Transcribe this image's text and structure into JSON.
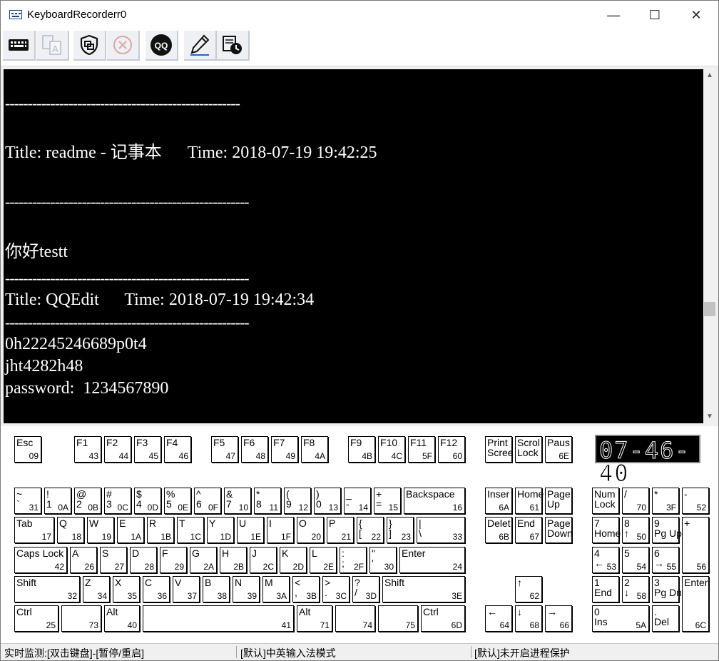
{
  "window": {
    "title": "KeyboardRecorderr0",
    "minimize": "—",
    "maximize": "☐",
    "close": "✕"
  },
  "toolbar": [
    {
      "name": "keyboard-icon",
      "enabled": true
    },
    {
      "name": "translate-icon",
      "enabled": false
    },
    {
      "name": "shield-icon",
      "enabled": true
    },
    {
      "name": "stop-icon",
      "enabled": false
    },
    {
      "name": "qq-icon",
      "label": "QQ",
      "enabled": true
    },
    {
      "name": "pencil-icon",
      "enabled": true
    },
    {
      "name": "log-clock-icon",
      "enabled": true
    }
  ],
  "console": {
    "lines": [
      {
        "text": "----------------------------------------------------",
        "dash": true
      },
      {
        "text": "Title: readme - 记事本      Time: 2018-07-19 19:42:25",
        "dash": false
      },
      {
        "text": "------------------------------------------------------",
        "dash": true
      },
      {
        "text": "你好testt",
        "dash": false
      },
      {
        "text": "------------------------------------------------------",
        "dash": true
      },
      {
        "text": "Title: QQEdit      Time: 2018-07-19 19:42:34",
        "dash": false
      },
      {
        "text": "------------------------------------------------------",
        "dash": true
      },
      {
        "text": "0h22245246689p0t4",
        "dash": false
      },
      {
        "text": "jht4282h48",
        "dash": false
      },
      {
        "text": "password:  1234567890",
        "dash": false
      }
    ]
  },
  "clock": "07-46-40",
  "keys": [
    {
      "l": "Esc",
      "c": "09"
    },
    {
      "l": "F1",
      "c": "43"
    },
    {
      "l": "F2",
      "c": "44"
    },
    {
      "l": "F3",
      "c": "45"
    },
    {
      "l": "F4",
      "c": "46"
    },
    {
      "l": "F5",
      "c": "47"
    },
    {
      "l": "F6",
      "c": "48"
    },
    {
      "l": "F7",
      "c": "49"
    },
    {
      "l": "F8",
      "c": "4A"
    },
    {
      "l": "F9",
      "c": "4B"
    },
    {
      "l": "F10",
      "c": "4C"
    },
    {
      "l": "F11",
      "c": "5F"
    },
    {
      "l": "F12",
      "c": "60"
    },
    {
      "l": "Print\nScree",
      "c": ""
    },
    {
      "l": "Scrol\nLock",
      "c": ""
    },
    {
      "l": "Paus",
      "c": "6E"
    },
    {
      "l": "~\n`",
      "c": "31"
    },
    {
      "l": "!\n1",
      "c": "0A"
    },
    {
      "l": "@\n2",
      "c": "0B"
    },
    {
      "l": "#\n3",
      "c": "0C"
    },
    {
      "l": "$\n4",
      "c": "0D"
    },
    {
      "l": "%\n5",
      "c": "0E"
    },
    {
      "l": "^\n6",
      "c": "0F"
    },
    {
      "l": "&\n7",
      "c": "10"
    },
    {
      "l": "*\n8",
      "c": "11"
    },
    {
      "l": "(\n9",
      "c": "12"
    },
    {
      "l": ")\n0",
      "c": "13"
    },
    {
      "l": "_\n-",
      "c": "14"
    },
    {
      "l": "+\n=",
      "c": "15"
    },
    {
      "l": "Backspace",
      "c": "16"
    },
    {
      "l": "Tab",
      "c": "17"
    },
    {
      "l": "Q",
      "c": "18"
    },
    {
      "l": "W",
      "c": "19"
    },
    {
      "l": "E",
      "c": "1A"
    },
    {
      "l": "R",
      "c": "1B"
    },
    {
      "l": "T",
      "c": "1C"
    },
    {
      "l": "Y",
      "c": "1D"
    },
    {
      "l": "U",
      "c": "1E"
    },
    {
      "l": "I",
      "c": "1F"
    },
    {
      "l": "O",
      "c": "20"
    },
    {
      "l": "P",
      "c": "21"
    },
    {
      "l": "{\n[",
      "c": "22"
    },
    {
      "l": "}\n]",
      "c": "23"
    },
    {
      "l": "|\n\\",
      "c": "33"
    },
    {
      "l": "Caps Lock",
      "c": "42"
    },
    {
      "l": "A",
      "c": "26"
    },
    {
      "l": "S",
      "c": "27"
    },
    {
      "l": "D",
      "c": "28"
    },
    {
      "l": "F",
      "c": "29"
    },
    {
      "l": "G",
      "c": "2A"
    },
    {
      "l": "H",
      "c": "2B"
    },
    {
      "l": "J",
      "c": "2C"
    },
    {
      "l": "K",
      "c": "2D"
    },
    {
      "l": "L",
      "c": "2E"
    },
    {
      "l": ":\n;",
      "c": "2F"
    },
    {
      "l": "\"\n'",
      "c": "30"
    },
    {
      "l": "Enter",
      "c": "24"
    },
    {
      "l": "Shift",
      "c": "32"
    },
    {
      "l": "Z",
      "c": "34"
    },
    {
      "l": "X",
      "c": "35"
    },
    {
      "l": "C",
      "c": "36"
    },
    {
      "l": "V",
      "c": "37"
    },
    {
      "l": "B",
      "c": "38"
    },
    {
      "l": "N",
      "c": "39"
    },
    {
      "l": "M",
      "c": "3A"
    },
    {
      "l": "<\n,",
      "c": "3B"
    },
    {
      "l": ">\n.",
      "c": "3C"
    },
    {
      "l": "?\n/",
      "c": "3D"
    },
    {
      "l": "Shift",
      "c": "3E"
    },
    {
      "l": "Ctrl",
      "c": "25"
    },
    {
      "l": "",
      "c": "73"
    },
    {
      "l": "Alt",
      "c": "40"
    },
    {
      "l": "",
      "c": "41"
    },
    {
      "l": "Alt",
      "c": "71"
    },
    {
      "l": "",
      "c": "74"
    },
    {
      "l": "",
      "c": "75"
    },
    {
      "l": "Ctrl",
      "c": "6D"
    },
    {
      "l": "Inser",
      "c": "6A"
    },
    {
      "l": "Home",
      "c": "61"
    },
    {
      "l": "Page\nUp",
      "c": ""
    },
    {
      "l": "Delet",
      "c": "6B"
    },
    {
      "l": "End",
      "c": "67"
    },
    {
      "l": "Page\nDown",
      "c": ""
    },
    {
      "l": "↑",
      "c": "62"
    },
    {
      "l": "←",
      "c": "64"
    },
    {
      "l": "↓",
      "c": "68"
    },
    {
      "l": "→",
      "c": "66"
    },
    {
      "l": "Num\nLock",
      "c": ""
    },
    {
      "l": "/",
      "c": "70"
    },
    {
      "l": "*",
      "c": "3F"
    },
    {
      "l": "-",
      "c": "52"
    },
    {
      "l": "7\nHome",
      "c": ""
    },
    {
      "l": "8\n↑",
      "c": "50"
    },
    {
      "l": "9\nPg Up",
      "c": ""
    },
    {
      "l": "+",
      "c": "56"
    },
    {
      "l": "4\n←",
      "c": "53"
    },
    {
      "l": "5",
      "c": "54"
    },
    {
      "l": "6\n→",
      "c": "55"
    },
    {
      "l": "1\nEnd",
      "c": ""
    },
    {
      "l": "2\n↓",
      "c": "58"
    },
    {
      "l": "3\nPg Dn",
      "c": ""
    },
    {
      "l": "Enter",
      "c": "6C"
    },
    {
      "l": "0\nIns",
      "c": "5A"
    },
    {
      "l": ".\nDel",
      "c": ""
    }
  ],
  "status": {
    "left": "实时监测:[双击键盘]-[暂停/重启]",
    "middle": "[默认]中英输入法模式",
    "right": "[默认]未开启进程保护"
  }
}
